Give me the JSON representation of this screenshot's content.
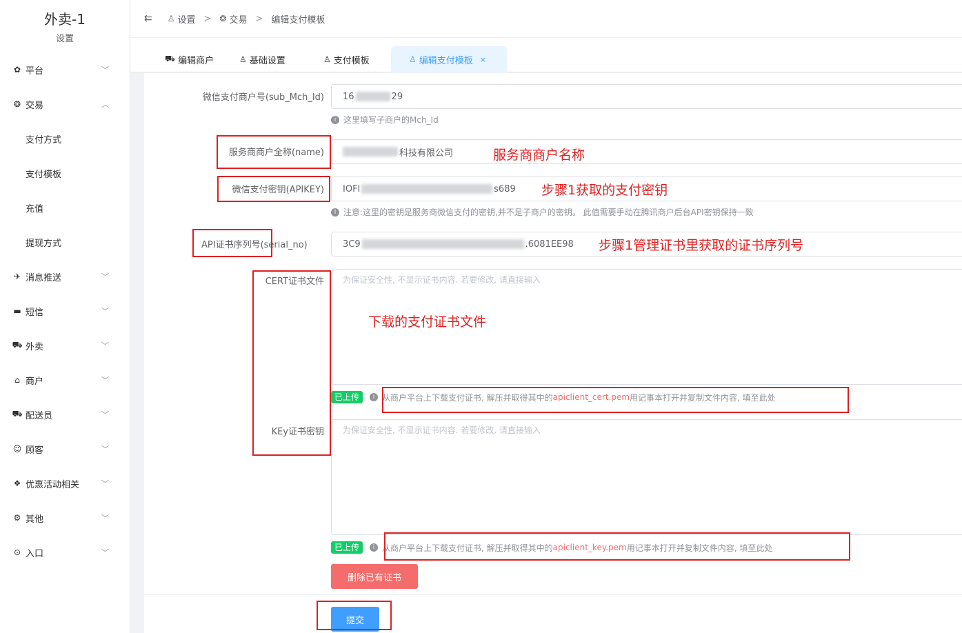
{
  "sidebar": {
    "app_name": "外卖-1",
    "app_sub": "设置",
    "items": [
      {
        "label": "平台",
        "icon": "gear-icon",
        "glyph": "✿",
        "expanded": false
      },
      {
        "label": "交易",
        "icon": "trade-icon",
        "glyph": "❂",
        "expanded": true
      },
      {
        "label": "支付方式"
      },
      {
        "label": "支付模板"
      },
      {
        "label": "充值"
      },
      {
        "label": "提现方式"
      },
      {
        "label": "消息推送",
        "icon": "send-icon",
        "glyph": "✈",
        "expanded": false
      },
      {
        "label": "短信",
        "icon": "sms-icon",
        "glyph": "▬",
        "expanded": false
      },
      {
        "label": "外卖",
        "icon": "truck-icon",
        "glyph": "⛟",
        "expanded": false
      },
      {
        "label": "商户",
        "icon": "shop-icon",
        "glyph": "⌂",
        "expanded": false
      },
      {
        "label": "配送员",
        "icon": "delivery-icon",
        "glyph": "⛟",
        "expanded": false
      },
      {
        "label": "顾客",
        "icon": "user-circle-icon",
        "glyph": "☺",
        "expanded": false
      },
      {
        "label": "优惠活动相关",
        "icon": "gift-icon",
        "glyph": "❖",
        "expanded": false
      },
      {
        "label": "其他",
        "icon": "settings-icon",
        "glyph": "⚙",
        "expanded": false
      },
      {
        "label": "入口",
        "icon": "compass-icon",
        "glyph": "⊙",
        "expanded": false
      }
    ]
  },
  "breadcrumb": {
    "items": [
      "设置",
      "交易",
      "编辑支付模板"
    ],
    "separator": ">"
  },
  "tabs": [
    {
      "label": "编辑商户"
    },
    {
      "label": "基础设置"
    },
    {
      "label": "支付模板"
    },
    {
      "label": "编辑支付模板",
      "active": true,
      "close": "×"
    }
  ],
  "form": {
    "sub_mch_id": {
      "label": "微信支付商户号(sub_Mch_Id)",
      "value_start": "16",
      "value_end": "29",
      "hint": "这里填写子商户的Mch_Id"
    },
    "name": {
      "label": "服务商商户全称(name)",
      "value_start": "",
      "value_end": "科技有限公司"
    },
    "apikey": {
      "label": "微信支付密钥(APIKEY)",
      "value_start": "IOFl",
      "value_end": "s689",
      "hint": "注意:这里的密钥是服务商微信支付的密钥,并不是子商户的密钥。 此值需要手动在腾讯商户后台API密钥保持一致"
    },
    "serial_no": {
      "label_main": "API证书序列号",
      "label_suffix": "(serial_no)",
      "value_start": "3C9",
      "value_end": ".6081EE98"
    },
    "cert": {
      "label": "CERT证书文件",
      "placeholder": "为保证安全性, 不显示证书内容. 若要修改, 请直接输入",
      "tag": "已上传",
      "hint_pre": "从商户平台上下载支付证书, 解压并取得其中的 ",
      "hint_file": "apiclient_cert.pem",
      "hint_post": " 用记事本打开并复制文件内容, 填至此处"
    },
    "key": {
      "label": "KEy证书密钥",
      "placeholder": "为保证安全性, 不显示证书内容. 若要修改, 请直接输入",
      "tag": "已上传",
      "hint_pre": "从商户平台上下载支付证书, 解压并取得其中的 ",
      "hint_file": "apiclient_key.pem",
      "hint_post": " 用记事本打开并复制文件内容, 填至此处"
    },
    "delete_button": "删除已有证书",
    "submit_button": "提交"
  },
  "annotations": {
    "name_note": "服务商商户名称",
    "apikey_note": "步骤1获取的支付密钥",
    "serial_note": "步骤1管理证书里获取的证书序列号",
    "cert_note": "下载的支付证书文件",
    "color": "#e02020"
  },
  "colors": {
    "primary": "#409eff",
    "danger": "#f56c6c",
    "success": "#13ce66"
  }
}
